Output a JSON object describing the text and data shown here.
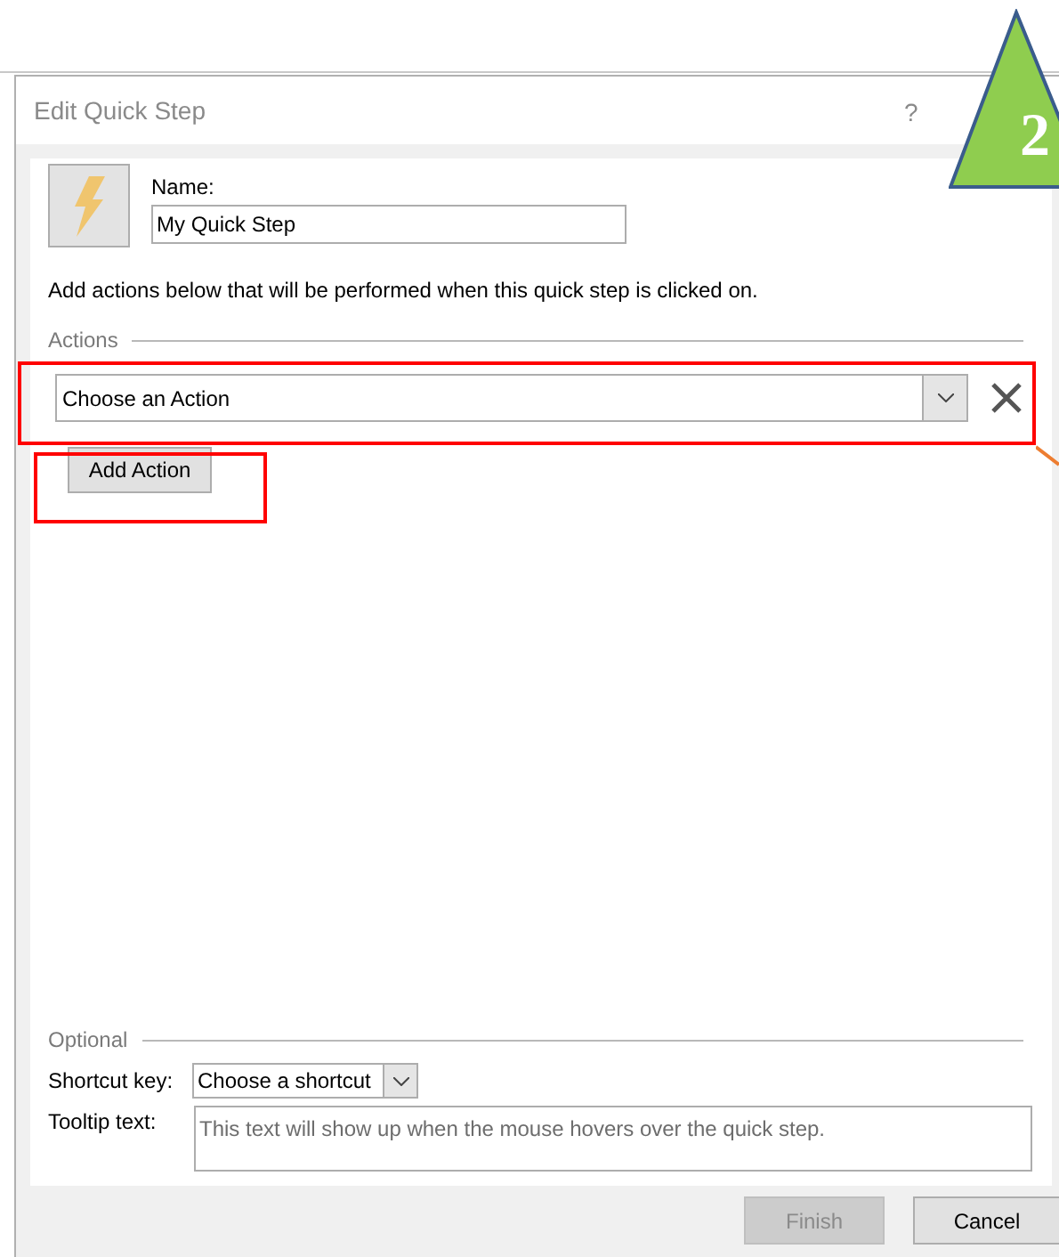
{
  "window": {
    "title": "Edit Quick Step",
    "help": "?"
  },
  "name_field": {
    "label": "Name:",
    "value": "My Quick Step"
  },
  "description": "Add actions below that will be performed when this quick step is clicked on.",
  "actions": {
    "label": "Actions",
    "items": [
      {
        "value": "Choose an Action"
      }
    ],
    "add_button": {
      "label": "Add Action"
    }
  },
  "optional": {
    "label": "Optional",
    "shortcut": {
      "label": "Shortcut key:",
      "value": "Choose a shortcut"
    },
    "tooltip": {
      "label": "Tooltip text:",
      "placeholder": "This text will show up when the mouse hovers over the quick step."
    }
  },
  "buttons": [
    {
      "label": "Finish",
      "disabled": true
    },
    {
      "label": "Cancel",
      "disabled": false
    }
  ],
  "annotation": {
    "number": "2"
  }
}
